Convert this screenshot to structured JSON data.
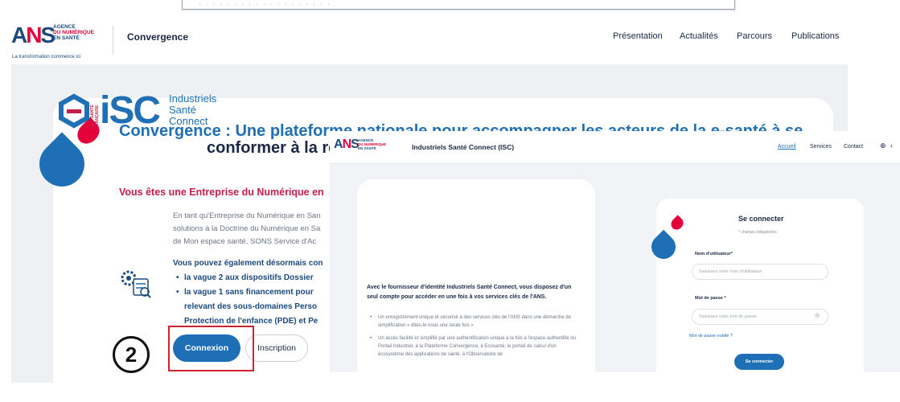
{
  "header": {
    "logo_text": "ANS",
    "agency_lines": [
      "AGENCE",
      "DU NUMÉRIQUE",
      "EN SANTÉ"
    ],
    "tagline": "La transformation commence ici",
    "site_title": "Convergence",
    "nav": [
      "Présentation",
      "Actualités",
      "Parcours",
      "Publications"
    ]
  },
  "main": {
    "title_line1": "Convergence : Une plateforme nationale pour accompagner les acteurs de la e-santé à se",
    "title_line2": "conformer à la ré",
    "subtitle": "Vous êtes une Entreprise du Numérique en",
    "para_lines": [
      "En tant qu'Entreprise du Numérique en San",
      "solutions à la Doctrine du Numérique en Sa",
      "de Mon espace santé, SONS Service d'Ac"
    ],
    "para2_lead": "Vous pouvez également désormais con",
    "para2_bullets": [
      "la vague 2 aux dispositifs Dossier",
      "la vague 1 sans financement pour"
    ],
    "para2_cont": [
      "relevant des sous-domaines Perso",
      "Protection de l'enfance (PDE) et Pe"
    ],
    "btn_connexion": "Connexion",
    "btn_inscription": "Inscription",
    "step_number": "2"
  },
  "overlay": {
    "title": "Industriels Santé Connect (ISC)",
    "nav": [
      "Accueil",
      "Services",
      "Contact"
    ],
    "isc_vertical": "LA E-SANTÉ FRANÇAISE",
    "isc_big": "iSC",
    "isc_words": [
      "Industriels",
      "Santé",
      "Connect"
    ],
    "intro": "Avec le fournisseur d'identité Industriels Santé Connect, vous disposez d'un seul compte pour accéder en une fois à vos services clés de l'ANS.",
    "bullets": [
      "Un enregistrement unique et sécurisé à des services clés de l'ANS dans une démarche de simplification « dites-le nous une seule fois »",
      "Un accès facilité et simplifié par une authentification unique à la fois à l'espace authentifié du Portail Industriel, à la Plateforme Convergence, à Ecosanté, le portail de calcul d'un écosystème des applications de santé, à l'Observatoire de"
    ],
    "login": {
      "title": "Se connecter",
      "required": "* champs obligatoires",
      "user_label": "Nom d'utilisateur*",
      "user_placeholder": "Saisissez votre nom d'utilisateur",
      "pass_label": "Mot de passe *",
      "pass_placeholder": "Saisissez votre mot de passe",
      "forgot": "Mot de passe oublié ?",
      "submit": "Se connecter"
    }
  },
  "colors": {
    "brand_blue": "#1f6fb6",
    "brand_red": "#e4003a",
    "subtitle_red": "#c41e4a",
    "highlight_box": "#d0242a"
  }
}
